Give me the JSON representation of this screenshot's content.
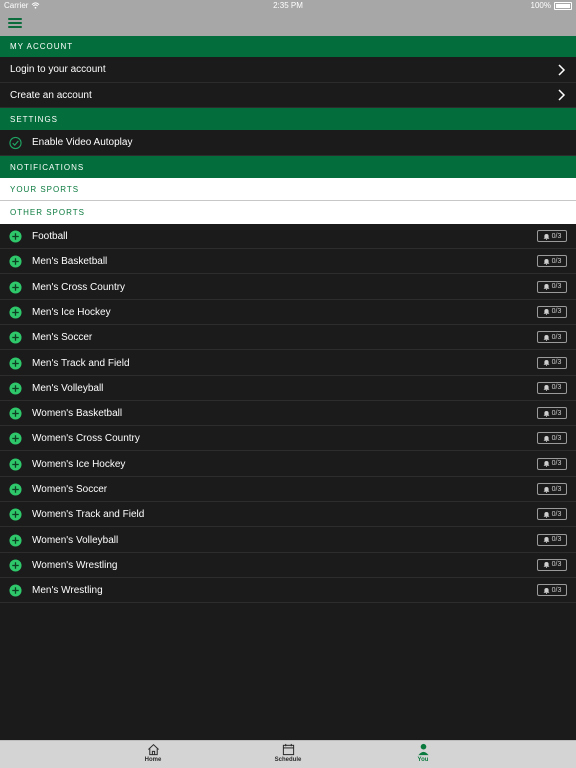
{
  "status_bar": {
    "carrier": "Carrier",
    "time": "2:35 PM",
    "battery": "100%"
  },
  "colors": {
    "accent": "#036e3b",
    "check": "#1fa463",
    "plus": "#2ec86b",
    "tab_active": "#0a7a3e"
  },
  "sections": {
    "my_account": "MY ACCOUNT",
    "settings": "SETTINGS",
    "notifications": "NOTIFICATIONS",
    "your_sports": "YOUR SPORTS",
    "other_sports": "OTHER SPORTS"
  },
  "account": {
    "login": "Login to your account",
    "create": "Create an account"
  },
  "settings": {
    "autoplay": "Enable Video Autoplay",
    "autoplay_enabled": true
  },
  "sports": [
    {
      "name": "Football",
      "count": "0/3"
    },
    {
      "name": "Men's Basketball",
      "count": "0/3"
    },
    {
      "name": "Men's Cross Country",
      "count": "0/3"
    },
    {
      "name": "Men's Ice Hockey",
      "count": "0/3"
    },
    {
      "name": "Men's Soccer",
      "count": "0/3"
    },
    {
      "name": "Men's Track and Field",
      "count": "0/3"
    },
    {
      "name": "Men's Volleyball",
      "count": "0/3"
    },
    {
      "name": "Women's Basketball",
      "count": "0/3"
    },
    {
      "name": "Women's Cross Country",
      "count": "0/3"
    },
    {
      "name": "Women's Ice Hockey",
      "count": "0/3"
    },
    {
      "name": "Women's Soccer",
      "count": "0/3"
    },
    {
      "name": "Women's Track and Field",
      "count": "0/3"
    },
    {
      "name": "Women's Volleyball",
      "count": "0/3"
    },
    {
      "name": "Women's Wrestling",
      "count": "0/3"
    },
    {
      "name": "Men's Wrestling",
      "count": "0/3"
    }
  ],
  "tabs": [
    {
      "label": "Home",
      "icon": "home-icon"
    },
    {
      "label": "Schedule",
      "icon": "calendar-icon"
    },
    {
      "label": "You",
      "icon": "person-icon",
      "active": true
    }
  ]
}
